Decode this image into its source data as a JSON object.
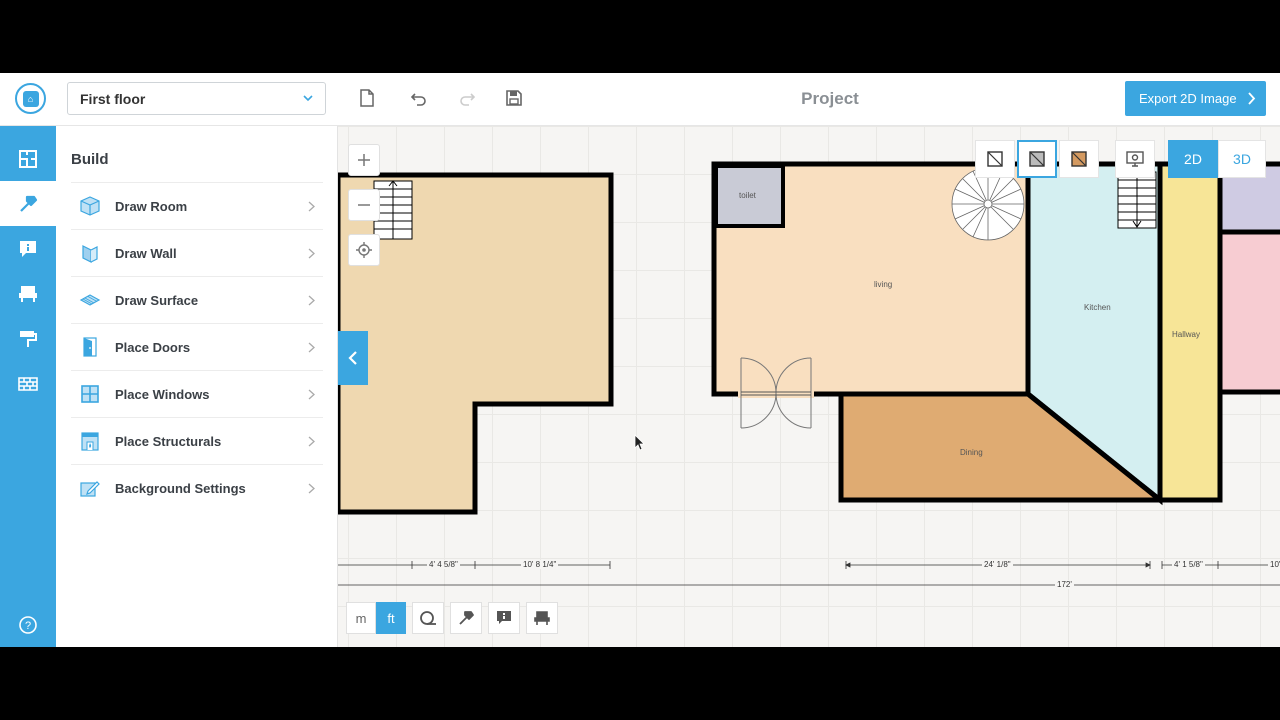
{
  "header": {
    "floor_selected": "First floor",
    "project_title": "Project",
    "export_label": "Export 2D Image"
  },
  "rail": {
    "items": [
      "floorplan-icon",
      "hammer-icon",
      "info-icon",
      "chair-icon",
      "paint-roller-icon",
      "brick-icon"
    ],
    "help": "help-icon"
  },
  "panel": {
    "title": "Build",
    "items": [
      {
        "label": "Draw Room",
        "icon": "room-cube-icon"
      },
      {
        "label": "Draw Wall",
        "icon": "wall-icon"
      },
      {
        "label": "Draw Surface",
        "icon": "surface-icon"
      },
      {
        "label": "Place Doors",
        "icon": "door-icon"
      },
      {
        "label": "Place Windows",
        "icon": "window-icon"
      },
      {
        "label": "Place Structurals",
        "icon": "fireplace-icon"
      },
      {
        "label": "Background Settings",
        "icon": "edit-background-icon"
      }
    ]
  },
  "canvas": {
    "mode_2d": "2D",
    "mode_3d": "3D",
    "rooms": {
      "toilet": "toilet",
      "living": "living",
      "kitchen": "Kitchen",
      "hallway": "Hallway",
      "dining": "Dining"
    },
    "dimensions": {
      "d1": "4' 4 5/8\"",
      "d2": "10' 8 1/4\"",
      "d3": "24' 1/8\"",
      "d4": "4' 1 5/8\"",
      "d5": "10'",
      "total": "172'"
    },
    "units": {
      "m": "m",
      "ft": "ft",
      "selected": "ft"
    }
  },
  "colors": {
    "accent": "#3ba6e0",
    "living": "#f9dfc0",
    "kitchen": "#d4eff1",
    "hallway": "#f7e597",
    "dining": "#dfab72",
    "left_room": "#efd8b0",
    "toilet": "#c9cbd6",
    "pink_room": "#f7ccd2",
    "lavender_room": "#cfcbe3"
  }
}
